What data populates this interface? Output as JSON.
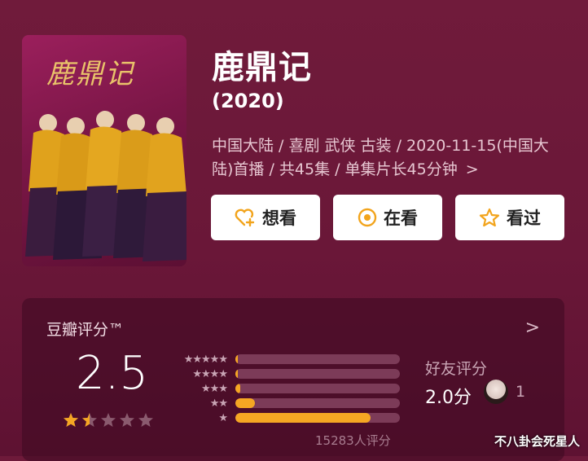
{
  "poster": {
    "title_art": "鹿鼎记"
  },
  "movie": {
    "title": "鹿鼎记",
    "year": "(2020)",
    "meta": "中国大陆 / 喜剧 武侠 古装 / 2020-11-15(中国大陆)首播 / 共45集 / 单集片长45分钟",
    "meta_chevron": ">"
  },
  "actions": {
    "want": "想看",
    "watching": "在看",
    "watched": "看过"
  },
  "rating": {
    "title": "豆瓣评分™",
    "chevron": ">",
    "score": "2.5",
    "star_value": 1.5,
    "distribution": [
      {
        "label": "★★★★★",
        "fraction": 0.01
      },
      {
        "label": "★★★★",
        "fraction": 0.01
      },
      {
        "label": "★★★",
        "fraction": 0.03
      },
      {
        "label": "★★",
        "fraction": 0.12
      },
      {
        "label": "★",
        "fraction": 0.82
      }
    ],
    "count_text": "15283人评分",
    "friend_label": "好友评分",
    "friend_score": "2.0分",
    "friend_count": "1"
  },
  "watermark": "不八卦会死星人",
  "colors": {
    "accent": "#f5a623",
    "background": "#6e1a3a",
    "icon_orange": "#f2a41c"
  }
}
